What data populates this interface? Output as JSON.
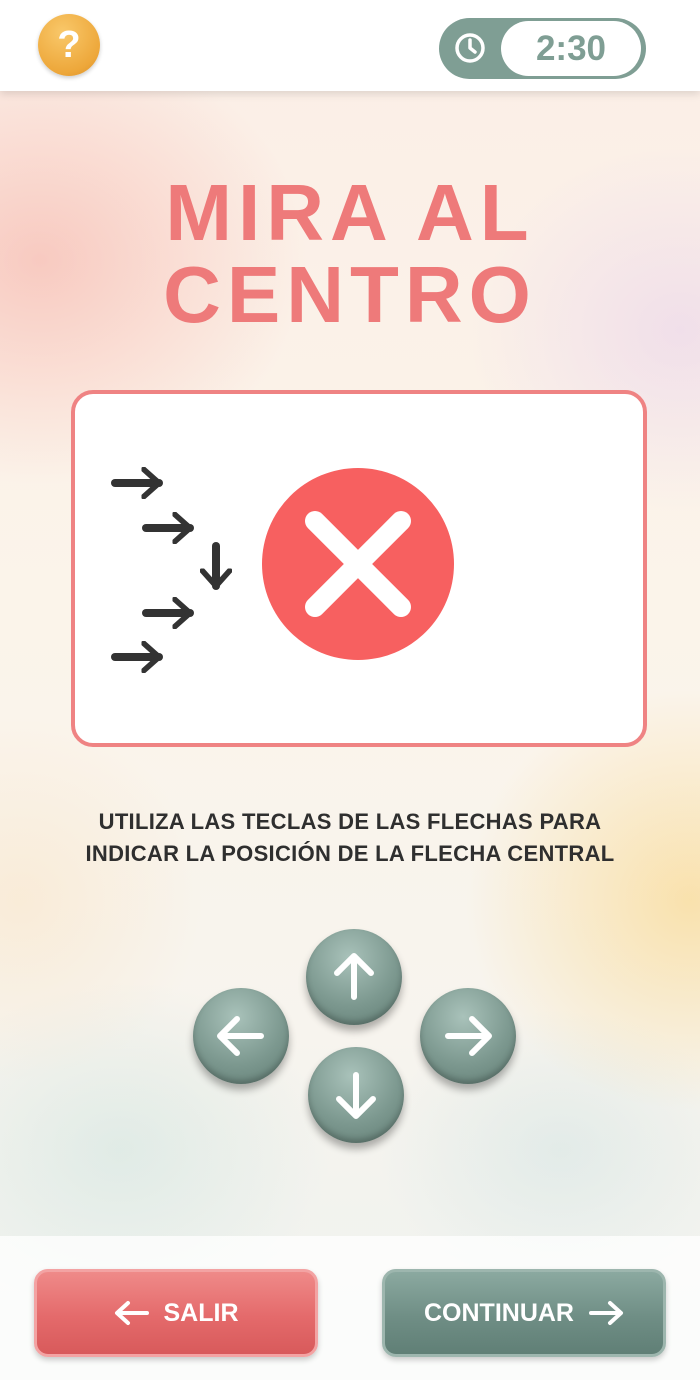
{
  "header": {
    "help_icon": "question-mark-icon",
    "help_label": "?",
    "timer_icon": "clock-icon",
    "timer_value": "2:30",
    "accent_color": "#7f9e94",
    "help_color": "#eda73a"
  },
  "title": {
    "line1": "MIRA AL",
    "line2": "CENTRO",
    "color": "#ee7a7a"
  },
  "example": {
    "arrows": [
      "right",
      "right",
      "down",
      "right",
      "right"
    ],
    "result_icon": "x-mark-icon",
    "result_color": "#f76060"
  },
  "instructions": {
    "line1": "UTILIZA LAS TECLAS DE LAS FLECHAS PARA",
    "line2": "INDICAR LA POSICIÓN DE LA FLECHA CENTRAL"
  },
  "arrow_keys": [
    "up",
    "left",
    "right",
    "down"
  ],
  "footer": {
    "exit_label": "SALIR",
    "exit_icon": "arrow-left-icon",
    "continue_label": "CONTINUAR",
    "continue_icon": "arrow-right-icon",
    "exit_color": "#e46a6b",
    "continue_color": "#6f8e85"
  }
}
